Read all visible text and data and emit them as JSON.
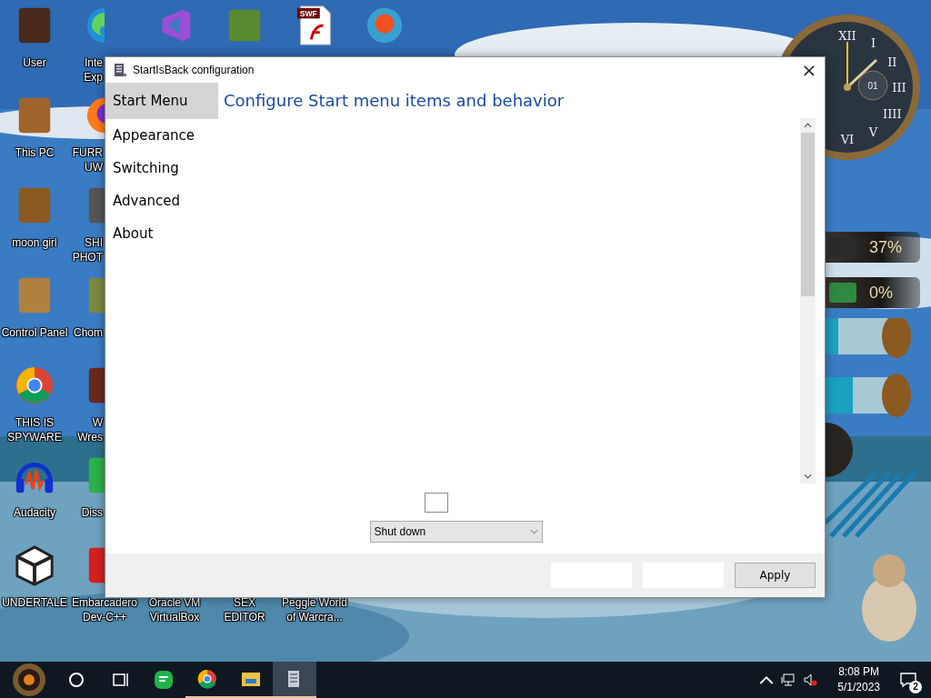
{
  "desktop": {
    "left_column": [
      {
        "kind": "wardrobe",
        "label": [
          "User"
        ]
      },
      {
        "kind": "computer",
        "label": [
          "This PC"
        ]
      },
      {
        "kind": "box",
        "label": [
          "moon girl"
        ]
      },
      {
        "kind": "lamp",
        "label": [
          "Control Panel"
        ]
      },
      {
        "kind": "chrome",
        "label": [
          "THIS IS",
          "SPYWARE"
        ]
      },
      {
        "kind": "audio",
        "label": [
          "Audacity"
        ]
      },
      {
        "kind": "unity",
        "label": [
          "UNDERTALE"
        ]
      }
    ],
    "second_column": [
      {
        "kind": "edge",
        "label": [
          "Inte",
          "Exp"
        ]
      },
      {
        "kind": "firefox",
        "label": [
          "FURR",
          "UW"
        ]
      },
      {
        "kind": "gimp",
        "label": [
          "SHI",
          "PHOT"
        ]
      },
      {
        "kind": "dog",
        "label": [
          "Chom"
        ]
      },
      {
        "kind": "book",
        "label": [
          "W",
          "Wres"
        ]
      },
      {
        "kind": "green",
        "label": [
          "Diss"
        ]
      },
      {
        "kind": "devcpp",
        "label": [
          "Embarcadero",
          "Dev-C++"
        ]
      }
    ],
    "top_row": [
      {
        "kind": "vs"
      },
      {
        "kind": "grass"
      },
      {
        "kind": "swf",
        "badge": "SWF"
      },
      {
        "kind": "peggle"
      }
    ],
    "bottom_row": [
      {
        "label": [
          "Oracle VM",
          "VirtualBox"
        ]
      },
      {
        "label": [
          "SEX",
          "EDITOR"
        ]
      },
      {
        "label": [
          "Peggle World",
          "of Warcra..."
        ]
      }
    ]
  },
  "gadgets": {
    "clock": {
      "numerals": [
        "XII",
        "I",
        "II",
        "III",
        "IIII",
        "V",
        "VI"
      ],
      "date": "01"
    },
    "meters": [
      {
        "reading": "37%",
        "kind": "dark"
      },
      {
        "reading": "0%",
        "kind": "green"
      }
    ]
  },
  "window": {
    "title": "StartIsBack configuration",
    "close": "×",
    "tabs": [
      {
        "label": "Start Menu",
        "selected": true
      },
      {
        "label": "Appearance",
        "selected": false
      },
      {
        "label": "Switching",
        "selected": false
      },
      {
        "label": "Advanced",
        "selected": false
      },
      {
        "label": "About",
        "selected": false
      }
    ],
    "heading": "Configure Start menu items and behavior",
    "checkbox": {
      "checked": false
    },
    "dropdown": {
      "value": "Shut down"
    },
    "buttons": [
      {
        "kind": "blank"
      },
      {
        "kind": "blank"
      },
      {
        "kind": "apply",
        "label": "Apply"
      }
    ]
  },
  "taskbar": {
    "apps": [
      {
        "kind": "search",
        "running": false,
        "selected": false
      },
      {
        "kind": "taskview",
        "running": false,
        "selected": false
      },
      {
        "kind": "chat",
        "running": false,
        "selected": false
      },
      {
        "kind": "chrome",
        "running": true,
        "selected": false
      },
      {
        "kind": "folder",
        "running": true,
        "selected": false
      },
      {
        "kind": "config",
        "running": true,
        "selected": true
      }
    ],
    "time": "8:08 PM",
    "date": "5/1/2023",
    "notifications": "2"
  }
}
